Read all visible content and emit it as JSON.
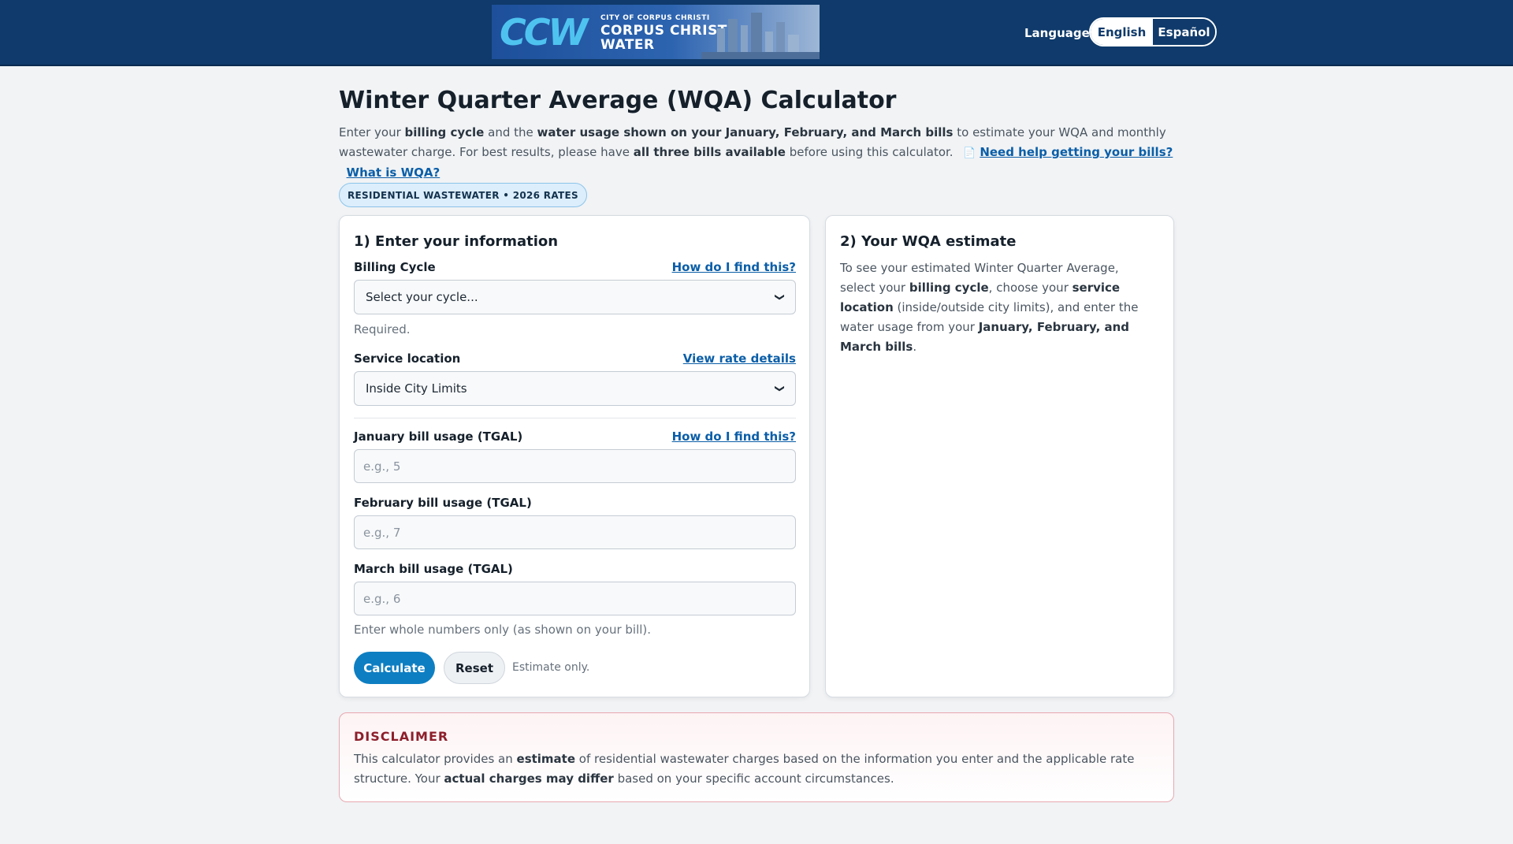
{
  "header": {
    "banner": {
      "logo_mark": "CCW",
      "small_text": "CITY OF CORPUS CHRISTI",
      "line1": "CORPUS CHRISTI",
      "line2": "WATER"
    },
    "language_label": "Language",
    "languages": [
      {
        "label": "English",
        "active": true
      },
      {
        "label": "Español",
        "active": false
      }
    ]
  },
  "page": {
    "title": "Winter Quarter Average (WQA) Calculator",
    "intro": {
      "p1": "Enter your ",
      "b1": "billing cycle",
      "p2": " and the ",
      "b2": "water usage shown on your January, February, and March bills",
      "p3": " to estimate your WQA and monthly wastewater charge. For best results, please have ",
      "b3": "all three bills available",
      "p4": " before using this calculator.",
      "help_link": "Need help getting your bills?",
      "wqa_link": "What is WQA?"
    },
    "badge": "RESIDENTIAL WASTEWATER • 2026 RATES"
  },
  "form": {
    "title": "1) Enter your information",
    "billing_cycle": {
      "label": "Billing Cycle",
      "help": "How do I find this?",
      "value": "Select your cycle...",
      "hint": "Required."
    },
    "service_location": {
      "label": "Service location",
      "help": "View rate details",
      "value": "Inside City Limits"
    },
    "january": {
      "label": "January bill usage (TGAL)",
      "help": "How do I find this?",
      "placeholder": "e.g., 5"
    },
    "february": {
      "label": "February bill usage (TGAL)",
      "placeholder": "e.g., 7"
    },
    "march": {
      "label": "March bill usage (TGAL)",
      "placeholder": "e.g., 6"
    },
    "numbers_hint": "Enter whole numbers only (as shown on your bill).",
    "calculate_label": "Calculate",
    "reset_label": "Reset",
    "estimate_note": "Estimate only."
  },
  "estimate": {
    "title": "2) Your WQA estimate",
    "t1": "To see your estimated Winter Quarter Average, select your ",
    "b1": "billing cycle",
    "t2": ", choose your ",
    "b2": "service location",
    "t3": " (inside/outside city limits), and enter the water usage from your ",
    "b3": "January, February, and March bills",
    "t4": "."
  },
  "disclaimer": {
    "title": "DISCLAIMER",
    "t1": "This calculator provides an ",
    "b1": "estimate",
    "t2": " of residential wastewater charges based on the information you enter and the applicable rate structure. Your ",
    "b2": "actual charges may differ",
    "t3": " based on your specific account circumstances."
  },
  "colors": {
    "header_bg": "#0f3a6b",
    "link": "#0a5ea8",
    "primary_button": "#0e7ec2",
    "disclaimer_title": "#8c1f2b"
  }
}
